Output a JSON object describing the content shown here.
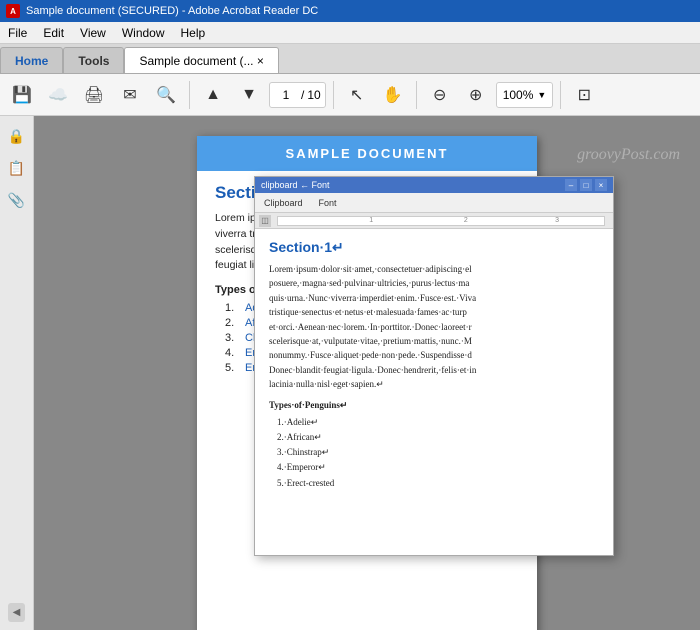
{
  "titlebar": {
    "title": "Sample document (SECURED) - Adobe Acrobat Reader DC",
    "app_icon": "A"
  },
  "menubar": {
    "items": [
      "File",
      "Edit",
      "View",
      "Window",
      "Help"
    ]
  },
  "tabs": [
    {
      "label": "Home",
      "active": false
    },
    {
      "label": "Tools",
      "active": false
    },
    {
      "label": "Sample document (... ×",
      "active": true
    }
  ],
  "toolbar": {
    "page_current": "1",
    "page_total": "10",
    "zoom_level": "100%"
  },
  "pdf": {
    "header": "SAMPLE DOCUMENT",
    "section_title": "Section 1",
    "body_text": "Lorem ipsum dolor sit a posuere, magna sed pu quis urna. Nunc viverra tristique senectus et ne et orci. Aenean nec lor scelerisque at, vulputat nonummy. Fusce aliqu Donec blandit feugiat li lacinia nulla nisl eget sa",
    "list_title": "Types of Penguins",
    "list_items": [
      {
        "num": "1.",
        "text": "Adelie"
      },
      {
        "num": "2.",
        "text": "African"
      },
      {
        "num": "3.",
        "text": "Chinstrap"
      },
      {
        "num": "4.",
        "text": "Emperor"
      },
      {
        "num": "5.",
        "text": "Erect-crested"
      }
    ],
    "watermark": "groovyPost.com"
  },
  "word": {
    "titlebar": "clipboard ←  Font",
    "section_title": "Section·1↵",
    "body_lines": [
      "Lorem·ipsum·dolor·sit·amet,·consectetuer·adipiscing·el",
      "posuere,·magna·sed·pulvinar·ultricies,·purus·lectus·ma",
      "quis·urna.·Nunc·viverra·imperdiet·enim.·Fusce·est.·Viva",
      "tristique·senectus·et·netus·et·malesuada·fames·ac·turp",
      "et·orci.·Aenean·nec·lorem.·In·porttitor.·Donec·laoreet·r",
      "scelerisque·at,·vulputate·vitae,·pretium·mattis,·nunc.·M",
      "nonummy.·Fusce·aliquet·pede·non·pede.·Suspendisse·d",
      "Donec·blandit·feugiat·ligula.·Donec·hendrerit,·felis·et·in",
      "lacinia·nulla·nisl·eget·sapien.↵"
    ],
    "list_title": "Types·of·Penguins↵",
    "list_items": [
      "1.·Adelie↵",
      "2.·African↵",
      "3.·Chinstrap↵",
      "4.·Emperor↵",
      "5.·Erect-crested"
    ],
    "ruler_marks": [
      "1",
      "2",
      "3"
    ]
  },
  "icons": {
    "save": "💾",
    "upload": "☁",
    "print": "🖨",
    "email": "✉",
    "search": "🔍",
    "prev": "▲",
    "next": "▼",
    "cursor": "↖",
    "hand": "✋",
    "zoom_out": "⊖",
    "zoom_in": "⊕",
    "fit": "⊡",
    "lock": "🔒",
    "layers": "📋",
    "attach": "📎"
  }
}
